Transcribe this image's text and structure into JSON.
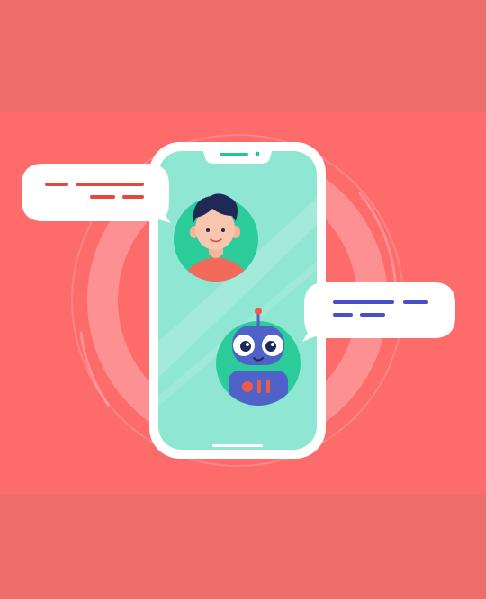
{
  "colors": {
    "band": "#ED6D6D",
    "background": "#FD6B6B",
    "phone_frame": "#FFFFFF",
    "phone_screen": "#8FE6D2",
    "speaker": "#1FC79A",
    "bubble": "#FFFFFF",
    "user_message_lines": "#E8463D",
    "bot_message_lines": "#4A4DCC",
    "robot_body": "#4E62C8",
    "robot_accent": "#F05A4A",
    "avatar_circle": "#2CCB9A"
  },
  "icons": {
    "user_avatar": "man-avatar-icon",
    "bot_avatar": "robot-avatar-icon"
  }
}
